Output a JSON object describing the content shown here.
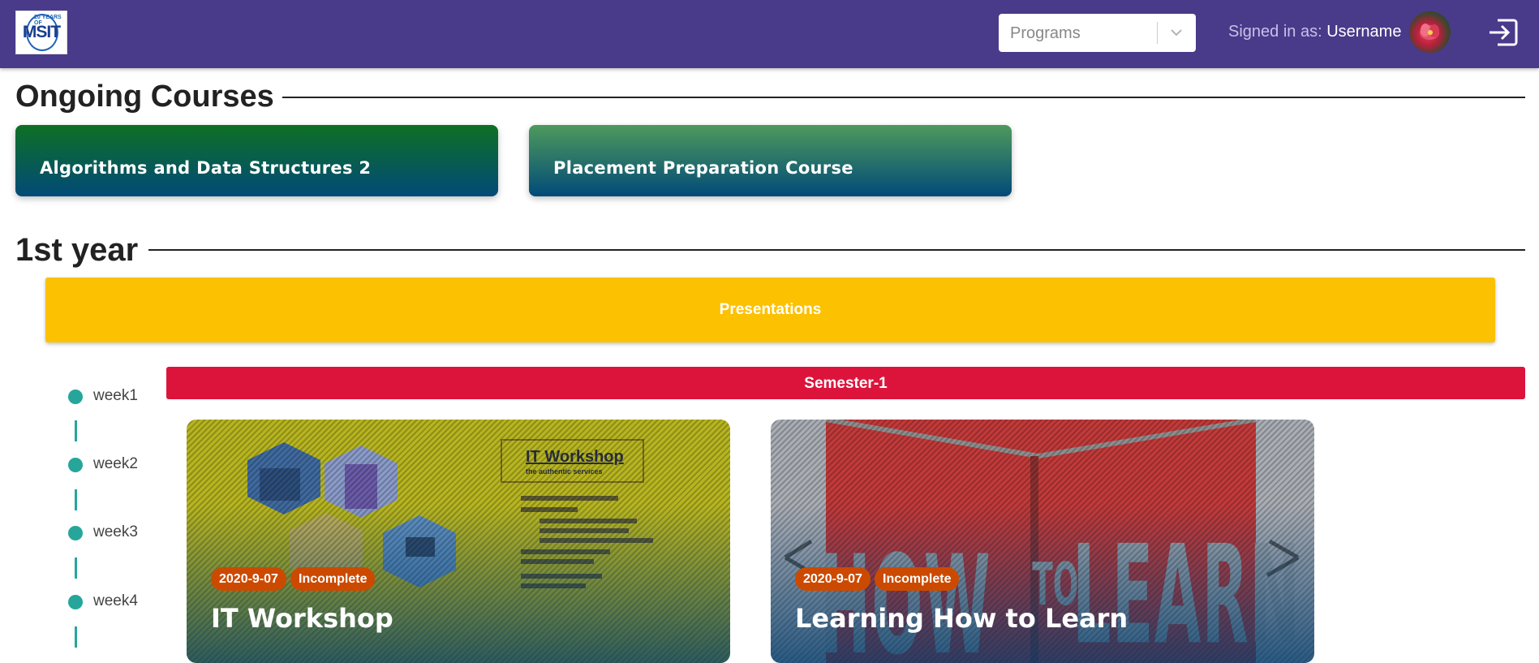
{
  "header": {
    "logo_text": "MSIT",
    "logo_subtext": "20 YEARS OF",
    "programs_select": {
      "placeholder": "Programs"
    },
    "signed_in_label": "Signed in as:",
    "username": "Username",
    "logout_icon": "logout-icon"
  },
  "sections": {
    "ongoing_title": "Ongoing Courses",
    "year_title": "1st year"
  },
  "ongoing_courses": [
    {
      "title": "Algorithms and Data Structures 2"
    },
    {
      "title": "Placement Preparation Course"
    }
  ],
  "presentations": {
    "label": "Presentations"
  },
  "timeline": {
    "weeks": [
      "week1",
      "week2",
      "week3",
      "week4"
    ]
  },
  "semester": {
    "label": "Semester-1"
  },
  "subjects": [
    {
      "title": "IT Workshop",
      "date": "2020-9-07",
      "status": "Incomplete"
    },
    {
      "title": "Learning How to Learn",
      "date": "2020-9-07",
      "status": "Incomplete"
    }
  ],
  "colors": {
    "header_bg": "#4a3a8a",
    "presentations_bg": "#fcc100",
    "semester_bg": "#dc143c",
    "timeline_accent": "#26a69a",
    "badge_bg": "#cc4a00"
  }
}
